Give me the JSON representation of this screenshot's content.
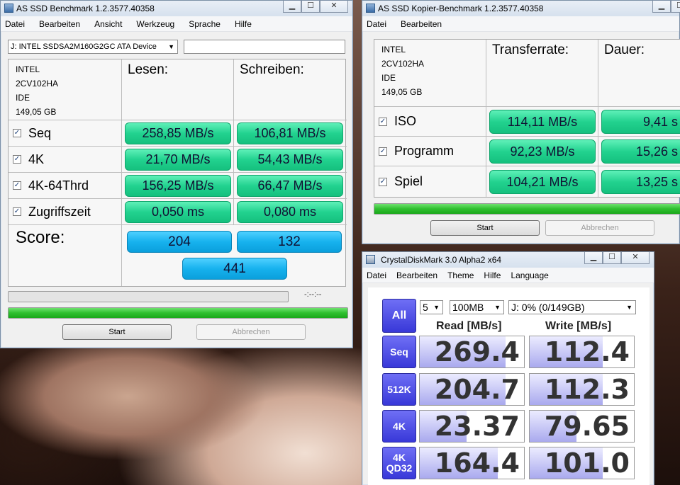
{
  "main_window": {
    "title": "AS SSD Benchmark 1.2.3577.40358",
    "menu": [
      "Datei",
      "Bearbeiten",
      "Ansicht",
      "Werkzeug",
      "Sprache",
      "Hilfe"
    ],
    "device_select": "J: INTEL SSDSA2M160G2GC ATA Device",
    "device_info": [
      "INTEL",
      "2CV102HA",
      "IDE",
      "149,05 GB"
    ],
    "col_read": "Lesen:",
    "col_write": "Schreiben:",
    "rows": [
      {
        "label": "Seq",
        "read": "258,85 MB/s",
        "write": "106,81 MB/s"
      },
      {
        "label": "4K",
        "read": "21,70 MB/s",
        "write": "54,43 MB/s"
      },
      {
        "label": "4K-64Thrd",
        "read": "156,25 MB/s",
        "write": "66,47 MB/s"
      },
      {
        "label": "Zugriffszeit",
        "read": "0,050 ms",
        "write": "0,080 ms"
      }
    ],
    "score_label": "Score:",
    "score_read": "204",
    "score_write": "132",
    "score_total": "441",
    "timer": "-:--:--",
    "start_label": "Start",
    "abort_label": "Abbrechen",
    "progress_top": 1.0
  },
  "copy_window": {
    "title": "AS SSD Kopier-Benchmark 1.2.3577.40358",
    "menu": [
      "Datei",
      "Bearbeiten"
    ],
    "device_info": [
      "INTEL",
      "2CV102HA",
      "IDE",
      "149,05 GB"
    ],
    "col_rate": "Transferrate:",
    "col_time": "Dauer:",
    "rows": [
      {
        "label": "ISO",
        "rate": "114,11 MB/s",
        "time": "9,41 s"
      },
      {
        "label": "Programm",
        "rate": "92,23 MB/s",
        "time": "15,26 s"
      },
      {
        "label": "Spiel",
        "rate": "104,21 MB/s",
        "time": "13,25 s"
      }
    ],
    "start_label": "Start",
    "abort_label": "Abbrechen",
    "progress": 1.0
  },
  "cdm_window": {
    "title": "CrystalDiskMark 3.0 Alpha2 x64",
    "menu": [
      "Datei",
      "Bearbeiten",
      "Theme",
      "Hilfe",
      "Language"
    ],
    "all_label": "All",
    "count_select": "5",
    "size_select": "100MB",
    "drive_select": "J: 0% (0/149GB)",
    "read_header": "Read [MB/s]",
    "write_header": "Write [MB/s]",
    "rows": [
      {
        "label": "Seq",
        "read": "269.4",
        "write": "112.4",
        "read_fill": 0.82,
        "write_fill": 0.7
      },
      {
        "label": "512K",
        "read": "204.7",
        "write": "112.3",
        "read_fill": 0.82,
        "write_fill": 0.7
      },
      {
        "label": "4K",
        "read": "23.37",
        "write": "79.65",
        "read_fill": 0.45,
        "write_fill": 0.45
      },
      {
        "label": "4K\nQD32",
        "label_line1": "4K",
        "label_line2": "QD32",
        "read": "164.4",
        "write": "101.0",
        "read_fill": 0.75,
        "write_fill": 0.7
      }
    ]
  },
  "colors": {
    "green_value": "#22d28f",
    "blue_score": "#17b2ee",
    "progress_green": "#2fbf2f",
    "cdm_label_blue": "#3838d8"
  }
}
